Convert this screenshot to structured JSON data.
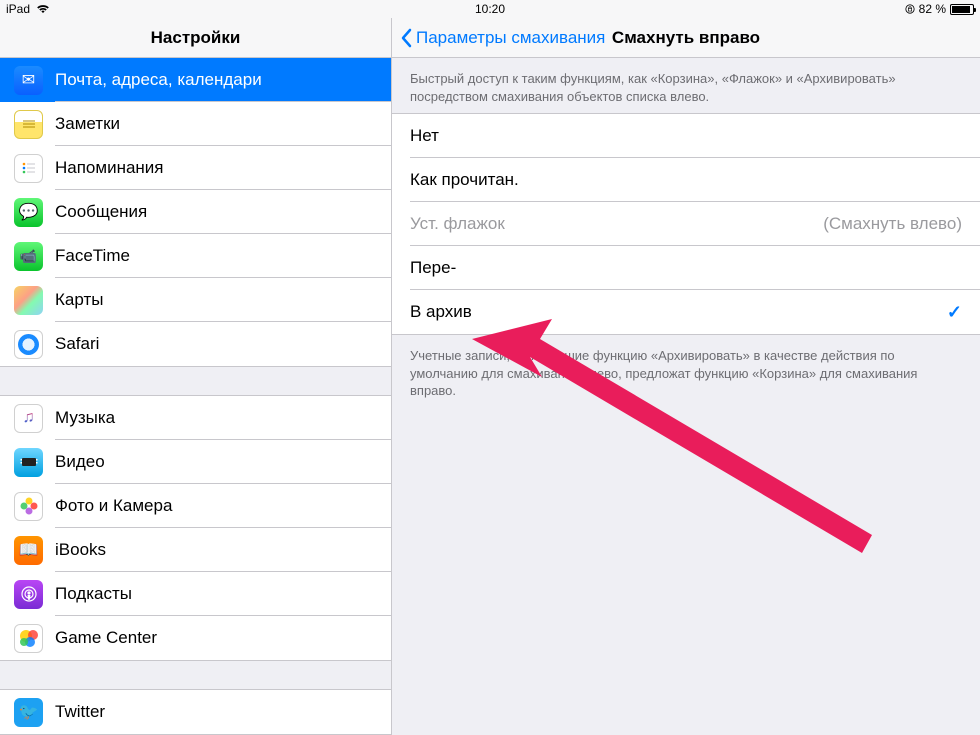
{
  "status": {
    "device": "iPad",
    "time": "10:20",
    "battery_text": "82 %",
    "battery_pct": 82
  },
  "nav": {
    "left_title": "Настройки",
    "back_label": "Параметры смахивания",
    "right_title": "Смахнуть вправо"
  },
  "sidebar": {
    "group1": [
      {
        "key": "mail",
        "label": "Почта, адреса, календари",
        "selected": true
      },
      {
        "key": "notes",
        "label": "Заметки"
      },
      {
        "key": "reminders",
        "label": "Напоминания"
      },
      {
        "key": "messages",
        "label": "Сообщения"
      },
      {
        "key": "facetime",
        "label": "FaceTime"
      },
      {
        "key": "maps",
        "label": "Карты"
      },
      {
        "key": "safari",
        "label": "Safari"
      }
    ],
    "group2": [
      {
        "key": "music",
        "label": "Музыка"
      },
      {
        "key": "video",
        "label": "Видео"
      },
      {
        "key": "photos",
        "label": "Фото и Камера"
      },
      {
        "key": "ibooks",
        "label": "iBooks"
      },
      {
        "key": "podcasts",
        "label": "Подкасты"
      },
      {
        "key": "gamecenter",
        "label": "Game Center"
      }
    ],
    "group3": [
      {
        "key": "twitter",
        "label": "Twitter"
      }
    ]
  },
  "detail": {
    "top_hint": "Быстрый доступ к таким функциям, как «Корзина», «Флажок» и «Архивировать» посредством смахивания объектов списка влево.",
    "options": [
      {
        "label": "Нет",
        "disabled": false,
        "selected": false
      },
      {
        "label": "Как прочитан.",
        "disabled": false,
        "selected": false
      },
      {
        "label": "Уст. флажок",
        "disabled": true,
        "selected": false,
        "sub": "(Смахнуть влево)"
      },
      {
        "label": "Пере-",
        "disabled": false,
        "selected": false
      },
      {
        "label": "В архив",
        "disabled": false,
        "selected": true
      }
    ],
    "bottom_hint": "Учетные записи, включившие функцию «Архивировать» в качестве действия по умолчанию для смахивания влево, предложат функцию «Корзина» для смахивания вправо."
  },
  "colors": {
    "blue": "#007aff",
    "arrow": "#e91d5b"
  },
  "icon_glyphs": {
    "mail": "✉",
    "messages": "💬",
    "facetime": "📹",
    "video": "▶",
    "ibooks": "📖",
    "podcasts": "◉",
    "twitter": "🐦"
  }
}
